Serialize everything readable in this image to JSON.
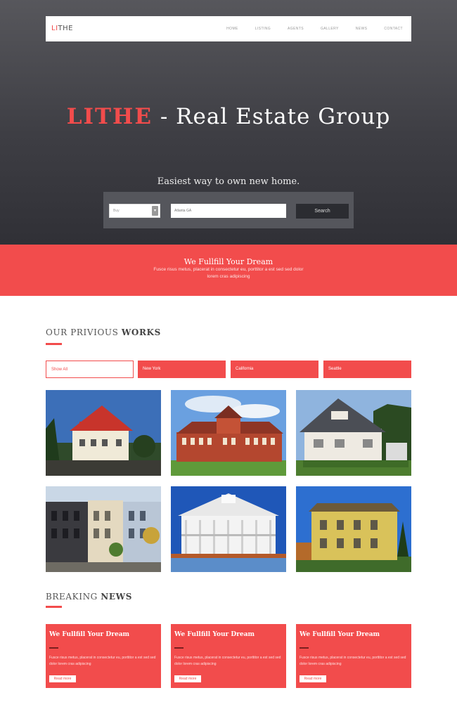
{
  "header": {
    "logo_accent": "LI",
    "logo_rest": "THE",
    "nav": [
      "HOME",
      "LISTING",
      "AGENTS",
      "GALLERY",
      "NEWS",
      "CONTACT"
    ]
  },
  "hero": {
    "brand": "LITHE",
    "title_rest": " - Real Estate Group",
    "subtitle": "Easiest way to own new home.",
    "select_value": "Buy",
    "location_placeholder": "Atlanta GA",
    "search_label": "Search"
  },
  "band": {
    "title": "We Fullfill Your Dream",
    "text": "Fusce risus metus, placerat in consectetur eu, porttitor a est sed sed dolor lorem cras adipiscing"
  },
  "works": {
    "title_light": "OUR PRIVIOUS ",
    "title_bold": "WORKS",
    "filters": [
      "Show All",
      "New York",
      "California",
      "Seattle"
    ]
  },
  "news": {
    "title_light": "BREAKING ",
    "title_bold": "NEWS",
    "cards": [
      {
        "title": "We Fullfill Your Dream",
        "text": "Fusce risus metus, placerat in consectetur eu, porttitor a est sed sed dolor lorem cras adipiscing",
        "button": "Read more"
      },
      {
        "title": "We Fullfill Your Dream",
        "text": "Fusce risus metus, placerat in consectetur eu, porttitor a est sed sed dolor lorem cras adipiscing",
        "button": "Read more"
      },
      {
        "title": "We Fullfill Your Dream",
        "text": "Fusce risus metus, placerat in consectetur eu, porttitor a est sed sed dolor lorem cras adipiscing",
        "button": "Read more"
      }
    ]
  },
  "colors": {
    "accent": "#f24c4c",
    "hero_dark": "#303036",
    "search_button": "#2b2c31"
  }
}
